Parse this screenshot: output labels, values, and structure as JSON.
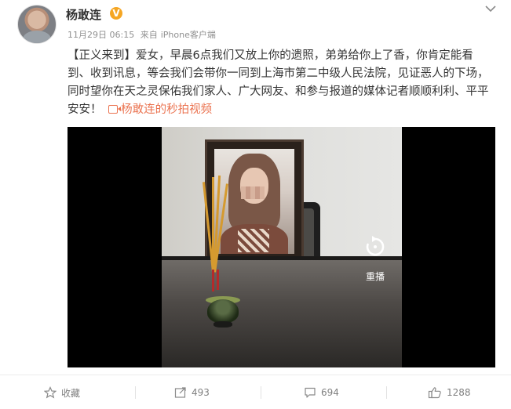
{
  "post": {
    "author": "杨敢连",
    "vip_badge": "V",
    "timestamp": "11月29日 06:15",
    "source_prefix": "来自",
    "source": "iPhone客户端",
    "text_tag": "【正义来到】",
    "text_body": "爱女，早晨6点我们又放上你的遗照，弟弟给你上了香，你肯定能看到、收到讯息，等会我们会带你一同到上海市第二中级人民法院，见证恶人的下场，同时望你在天之灵保佑我们家人、广大网友、和参与报道的媒体记者顺顺利利、平平安安！",
    "video_link": "杨敢连的秒拍视频"
  },
  "video": {
    "replay_label": "重播"
  },
  "actions": {
    "favorite": "收藏",
    "repost_count": "493",
    "comment_count": "694",
    "like_count": "1288"
  },
  "colors": {
    "link": "#eb7350",
    "badge": "#f5a623",
    "muted": "#808080"
  }
}
